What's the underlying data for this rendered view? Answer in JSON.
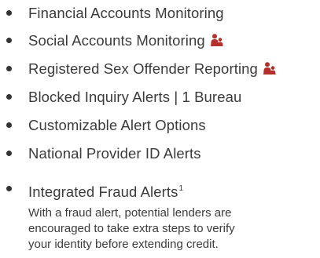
{
  "features": {
    "items": [
      {
        "label": "Financial Accounts Monitoring",
        "family_icon": false
      },
      {
        "label": "Social Accounts Monitoring",
        "family_icon": true
      },
      {
        "label": "Registered Sex Offender Reporting",
        "family_icon": true
      },
      {
        "label": "Blocked Inquiry Alerts | 1 Bureau",
        "family_icon": false
      },
      {
        "label": "Customizable Alert Options",
        "family_icon": false
      },
      {
        "label": "National Provider ID Alerts",
        "family_icon": false
      },
      {
        "label": "Integrated Fraud Alerts",
        "family_icon": false,
        "footnote": "1"
      }
    ],
    "description_lines": [
      "With a fraud alert, potential lenders are",
      "encouraged to take extra steps to verify",
      "your identity before extending credit."
    ]
  },
  "colors": {
    "text": "#3b3b3b",
    "bullet": "#333333",
    "family_icon": "#b5302a"
  },
  "icons": {
    "family": "family-icon"
  }
}
